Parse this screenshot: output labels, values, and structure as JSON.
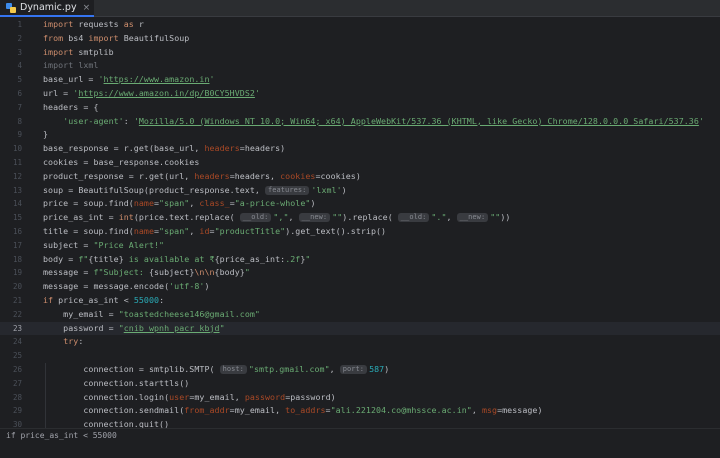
{
  "tab": {
    "filename": "Dynamic.py",
    "close": "×",
    "icon": "python-file-icon"
  },
  "current_line": 23,
  "lines": [
    {
      "n": "1",
      "tokens": [
        [
          "k",
          "import"
        ],
        [
          "t",
          " requests "
        ],
        [
          "k",
          "as"
        ],
        [
          "t",
          " r"
        ]
      ]
    },
    {
      "n": "2",
      "tokens": [
        [
          "k",
          "from"
        ],
        [
          "t",
          " bs4 "
        ],
        [
          "k",
          "import"
        ],
        [
          "t",
          " BeautifulSoup"
        ]
      ]
    },
    {
      "n": "3",
      "tokens": [
        [
          "k",
          "import"
        ],
        [
          "t",
          " smtplib"
        ]
      ]
    },
    {
      "n": "4",
      "tokens": [
        [
          "c",
          "import lxml"
        ]
      ]
    },
    {
      "n": "5",
      "tokens": [
        [
          "t",
          "base_url = "
        ],
        [
          "s",
          "'"
        ],
        [
          "sl",
          "https://www.amazon.in"
        ],
        [
          "s",
          "'"
        ]
      ]
    },
    {
      "n": "6",
      "tokens": [
        [
          "t",
          "url = "
        ],
        [
          "s",
          "'"
        ],
        [
          "sl",
          "https://www.amazon.in/dp/B0CY5HVDS2"
        ],
        [
          "s",
          "'"
        ]
      ]
    },
    {
      "n": "7",
      "tokens": [
        [
          "t",
          "headers = {"
        ]
      ]
    },
    {
      "n": "8",
      "tokens": [
        [
          "t",
          "    "
        ],
        [
          "s",
          "'user-agent'"
        ],
        [
          "t",
          ": "
        ],
        [
          "s",
          "'"
        ],
        [
          "sl",
          "Mozilla/5.0 (Windows NT 10.0; Win64; x64) AppleWebKit/537.36 (KHTML, like Gecko) Chrome/128.0.0.0 Safari/537.36"
        ],
        [
          "s",
          "'"
        ]
      ]
    },
    {
      "n": "9",
      "tokens": [
        [
          "t",
          "}"
        ]
      ]
    },
    {
      "n": "10",
      "tokens": [
        [
          "t",
          "base_response = r.get(base_url, "
        ],
        [
          "p",
          "headers"
        ],
        [
          "t",
          "=headers)"
        ]
      ]
    },
    {
      "n": "11",
      "tokens": [
        [
          "t",
          "cookies = base_response.cookies"
        ]
      ]
    },
    {
      "n": "12",
      "tokens": [
        [
          "t",
          "product_response = r.get(url, "
        ],
        [
          "p",
          "headers"
        ],
        [
          "t",
          "=headers, "
        ],
        [
          "p",
          "cookies"
        ],
        [
          "t",
          "=cookies)"
        ]
      ]
    },
    {
      "n": "13",
      "tokens": [
        [
          "t",
          "soup = BeautifulSoup(product_response.text, "
        ],
        [
          "h",
          "features:"
        ],
        [
          "s",
          "'lxml'"
        ],
        [
          "t",
          ")"
        ]
      ]
    },
    {
      "n": "14",
      "tokens": [
        [
          "t",
          "price = soup.find("
        ],
        [
          "p",
          "name"
        ],
        [
          "t",
          "="
        ],
        [
          "s",
          "\"span\""
        ],
        [
          "t",
          ", "
        ],
        [
          "p",
          "class_"
        ],
        [
          "t",
          "="
        ],
        [
          "s",
          "\"a-price-whole\""
        ],
        [
          "t",
          ")"
        ]
      ]
    },
    {
      "n": "15",
      "tokens": [
        [
          "t",
          "price_as_int = "
        ],
        [
          "k",
          "int"
        ],
        [
          "t",
          "(price.text.replace( "
        ],
        [
          "h",
          "__old:"
        ],
        [
          "s",
          "\",\""
        ],
        [
          "t",
          ", "
        ],
        [
          "h",
          "__new:"
        ],
        [
          "s",
          "\"\""
        ],
        [
          "t",
          ").replace( "
        ],
        [
          "h",
          "__old:"
        ],
        [
          "s",
          "\".\""
        ],
        [
          "t",
          ", "
        ],
        [
          "h",
          "__new:"
        ],
        [
          "s",
          "\"\""
        ],
        [
          "t",
          "))"
        ]
      ]
    },
    {
      "n": "16",
      "tokens": [
        [
          "t",
          "title = soup.find("
        ],
        [
          "p",
          "name"
        ],
        [
          "t",
          "="
        ],
        [
          "s",
          "\"span\""
        ],
        [
          "t",
          ", "
        ],
        [
          "p",
          "id"
        ],
        [
          "t",
          "="
        ],
        [
          "s",
          "\"productTitle\""
        ],
        [
          "t",
          ").get_text().strip()"
        ]
      ]
    },
    {
      "n": "17",
      "tokens": [
        [
          "t",
          "subject = "
        ],
        [
          "s",
          "\"Price Alert!\""
        ]
      ]
    },
    {
      "n": "18",
      "tokens": [
        [
          "t",
          "body = "
        ],
        [
          "s",
          "f\""
        ],
        [
          "t",
          "{title}"
        ],
        [
          "s",
          " is available at ₹"
        ],
        [
          "t",
          "{price_as_int:"
        ],
        [
          "s",
          ".2f"
        ],
        [
          "t",
          "}"
        ],
        [
          "s",
          "\""
        ]
      ]
    },
    {
      "n": "19",
      "tokens": [
        [
          "t",
          "message = "
        ],
        [
          "s",
          "f\"Subject: "
        ],
        [
          "t",
          "{subject}"
        ],
        [
          "k",
          "\\n\\n"
        ],
        [
          "t",
          "{body}"
        ],
        [
          "s",
          "\""
        ]
      ]
    },
    {
      "n": "20",
      "tokens": [
        [
          "t",
          "message = message.encode("
        ],
        [
          "s",
          "'utf-8'"
        ],
        [
          "t",
          ")"
        ]
      ]
    },
    {
      "n": "21",
      "tokens": [
        [
          "k",
          "if"
        ],
        [
          "t",
          " price_as_int < "
        ],
        [
          "n",
          "55000"
        ],
        [
          "t",
          ":"
        ]
      ]
    },
    {
      "n": "22",
      "tokens": [
        [
          "t",
          "    my_email = "
        ],
        [
          "s",
          "\"toastedcheese146@gmail.com\""
        ]
      ]
    },
    {
      "n": "23",
      "tokens": [
        [
          "t",
          "    password = "
        ],
        [
          "s",
          "\""
        ],
        [
          "sl",
          "cnib wpnh pacr kbjd"
        ],
        [
          "s",
          "\""
        ]
      ]
    },
    {
      "n": "24",
      "tokens": [
        [
          "t",
          "    "
        ],
        [
          "k",
          "try"
        ],
        [
          "t",
          ":"
        ]
      ]
    },
    {
      "n": "25",
      "tokens": []
    },
    {
      "n": "26",
      "tokens": [
        [
          "t",
          "        connection = smtplib.SMTP( "
        ],
        [
          "h",
          "host:"
        ],
        [
          "s",
          "\"smtp.gmail.com\""
        ],
        [
          "t",
          ", "
        ],
        [
          "h",
          "port:"
        ],
        [
          "n",
          "587"
        ],
        [
          "t",
          ")"
        ]
      ]
    },
    {
      "n": "27",
      "tokens": [
        [
          "t",
          "        connection.starttls()"
        ]
      ]
    },
    {
      "n": "28",
      "tokens": [
        [
          "t",
          "        connection.login("
        ],
        [
          "p",
          "user"
        ],
        [
          "t",
          "=my_email, "
        ],
        [
          "p",
          "password"
        ],
        [
          "t",
          "=password)"
        ]
      ]
    },
    {
      "n": "29",
      "tokens": [
        [
          "t",
          "        connection.sendmail("
        ],
        [
          "p",
          "from_addr"
        ],
        [
          "t",
          "=my_email, "
        ],
        [
          "p",
          "to_addrs"
        ],
        [
          "t",
          "="
        ],
        [
          "s",
          "\"ali.221204.co@mhssce.ac.in\""
        ],
        [
          "t",
          ", "
        ],
        [
          "p",
          "msg"
        ],
        [
          "t",
          "=message)"
        ]
      ]
    },
    {
      "n": "30",
      "tokens": [
        [
          "t",
          "        connection.quit()"
        ]
      ]
    }
  ],
  "statusbar": {
    "breadcrumb": "if price_as_int < 55000"
  }
}
